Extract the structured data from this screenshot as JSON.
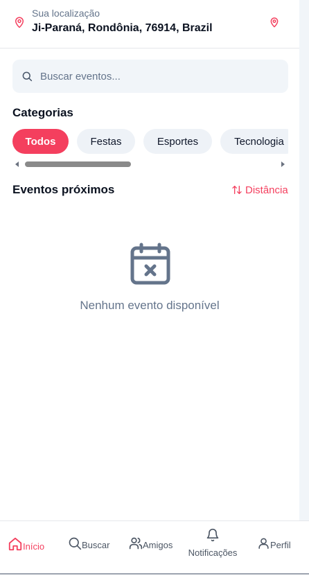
{
  "header": {
    "location_label": "Sua localização",
    "location_value": "Ji-Paraná, Rondônia, 76914, Brazil"
  },
  "search": {
    "placeholder": "Buscar eventos..."
  },
  "categories": {
    "title": "Categorias",
    "items": [
      {
        "label": "Todos",
        "active": true
      },
      {
        "label": "Festas",
        "active": false
      },
      {
        "label": "Esportes",
        "active": false
      },
      {
        "label": "Tecnologia",
        "active": false
      }
    ]
  },
  "events": {
    "title": "Eventos próximos",
    "sort_label": "Distância",
    "empty_message": "Nenhum evento disponível"
  },
  "nav": {
    "items": [
      {
        "label": "Início",
        "icon": "home-icon",
        "active": true
      },
      {
        "label": "Buscar",
        "icon": "search-icon",
        "active": false
      },
      {
        "label": "Amigos",
        "icon": "users-icon",
        "active": false
      },
      {
        "label": "Notificações",
        "icon": "bell-icon",
        "active": false
      },
      {
        "label": "Perfil",
        "icon": "user-icon",
        "active": false
      }
    ]
  },
  "colors": {
    "accent": "#f43f5e",
    "muted": "#64748b",
    "chip_bg": "#eef2f7"
  }
}
